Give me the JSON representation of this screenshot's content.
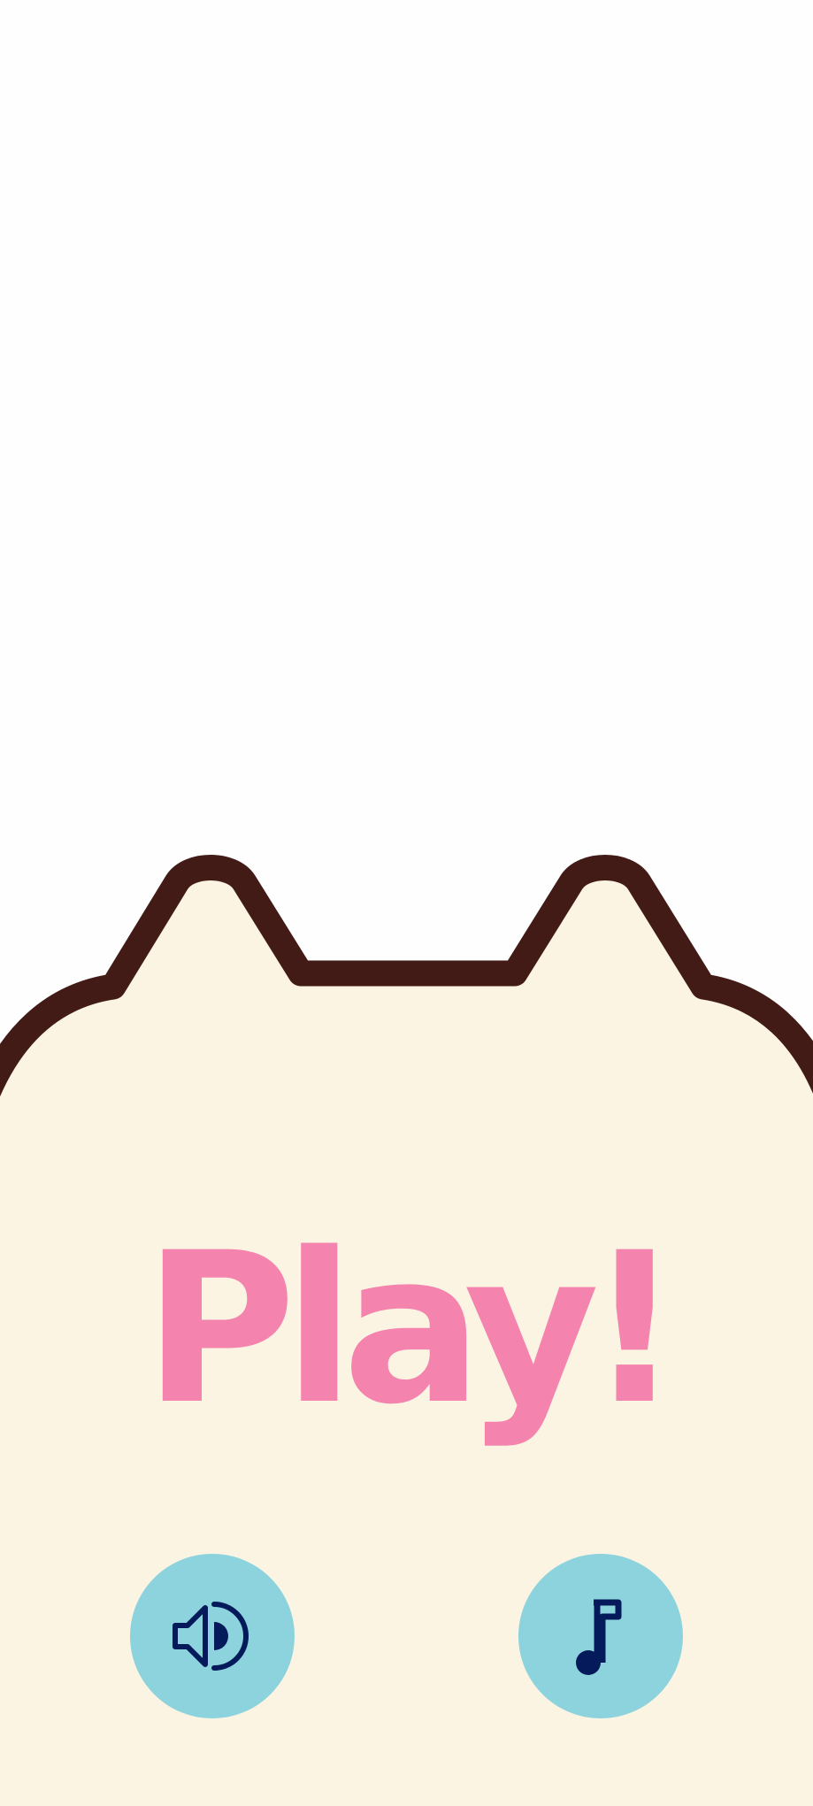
{
  "screen": {
    "title": "Play!"
  },
  "controls": {
    "sound": {
      "icon": "speaker-volume-icon"
    },
    "music": {
      "icon": "music-note-icon"
    }
  },
  "colors": {
    "background": "#fefefe",
    "cat_fill": "#fbf4e3",
    "cat_outline": "#421b16",
    "title": "#f483ae",
    "button_fill": "#8cd3dd",
    "icon": "#041a5a"
  }
}
